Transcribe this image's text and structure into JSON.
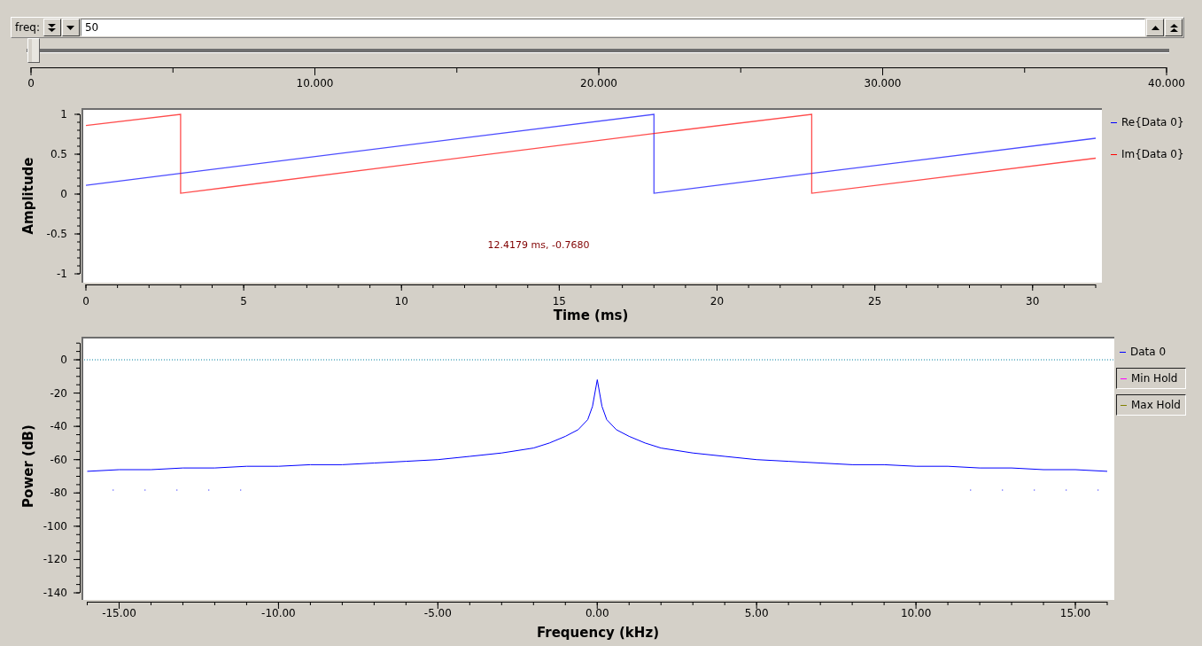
{
  "counter": {
    "label": "freq:",
    "value": "50"
  },
  "slider": {
    "level": 0.00125,
    "scale_labels": [
      "0",
      "10.000",
      "20.000",
      "30.000",
      "40.000"
    ]
  },
  "time_plot": {
    "chart_data": {
      "type": "line",
      "xlabel": "Time (ms)",
      "ylabel": "Amplitude",
      "xlim": [
        0,
        32
      ],
      "ylim": [
        -1,
        1
      ],
      "xticks": [
        0,
        5,
        10,
        15,
        20,
        25,
        30
      ],
      "yticks": [
        -1,
        -0.5,
        0,
        0.5,
        1
      ],
      "x": [
        0,
        3,
        3,
        18,
        18,
        23,
        23,
        32
      ],
      "series": [
        {
          "name": "Re{Data 0}",
          "color": "#0000ff",
          "values": [
            0.11,
            0.26,
            0.26,
            1.0,
            0.01,
            0.26,
            0.26,
            0.7
          ]
        },
        {
          "name": "Im{Data 0}",
          "color": "#ff0000",
          "values": [
            0.86,
            1.0,
            0.01,
            0.76,
            0.76,
            1.0,
            0.01,
            0.45
          ]
        }
      ],
      "annotations": [
        "12.4179 ms, -0.7680"
      ]
    }
  },
  "freq_plot": {
    "legend_toggles": [
      {
        "name": "Min Hold",
        "color": "#ff00ff"
      },
      {
        "name": "Max Hold",
        "color": "#808000"
      }
    ],
    "chart_data": {
      "type": "line",
      "xlabel": "Frequency (kHz)",
      "ylabel": "Power (dB)",
      "xlim": [
        -16,
        16
      ],
      "ylim": [
        -145,
        10
      ],
      "xticks": [
        {
          "value": -15,
          "label": "-15.00"
        },
        {
          "value": -10,
          "label": "-10.00"
        },
        {
          "value": -5,
          "label": "-5.00"
        },
        {
          "value": 0,
          "label": "0.00"
        },
        {
          "value": 5,
          "label": "5.00"
        },
        {
          "value": 10,
          "label": "10.00"
        },
        {
          "value": 15,
          "label": "15.00"
        }
      ],
      "yticks": [
        -140,
        -120,
        -100,
        -80,
        -60,
        -40,
        -20,
        0
      ],
      "x": [
        -16,
        -15,
        -14,
        -13,
        -12,
        -11,
        -10,
        -9,
        -8,
        -7,
        -6,
        -5,
        -4,
        -3,
        -2,
        -1.5,
        -1,
        -0.6,
        -0.3,
        -0.15,
        0,
        0.15,
        0.3,
        0.6,
        1,
        1.5,
        2,
        3,
        4,
        5,
        6,
        7,
        8,
        9,
        10,
        11,
        12,
        13,
        14,
        15,
        16
      ],
      "series": [
        {
          "name": "Data 0",
          "color": "#0000ff",
          "values": [
            -67,
            -66,
            -66,
            -65,
            -65,
            -64,
            -64,
            -63,
            -63,
            -62,
            -61,
            -60,
            -58,
            -56,
            -53,
            -50,
            -46,
            -42,
            -36,
            -28,
            -12,
            -28,
            -36,
            -42,
            -46,
            -50,
            -53,
            -56,
            -58,
            -60,
            -61,
            -62,
            -63,
            -63,
            -64,
            -64,
            -65,
            -65,
            -66,
            -66,
            -67
          ]
        }
      ]
    }
  }
}
